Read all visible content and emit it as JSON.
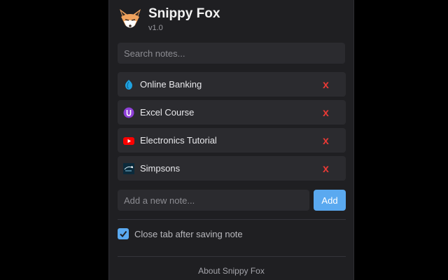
{
  "app": {
    "title": "Snippy Fox",
    "version": "v1.0"
  },
  "search": {
    "placeholder": "Search notes..."
  },
  "notes": [
    {
      "label": "Online Banking",
      "icon": "bank-icon",
      "delete_label": "x"
    },
    {
      "label": "Excel Course",
      "icon": "course-icon",
      "delete_label": "x"
    },
    {
      "label": "Electronics Tutorial",
      "icon": "youtube-icon",
      "delete_label": "x"
    },
    {
      "label": "Simpsons",
      "icon": "disney-plus-icon",
      "delete_label": "x"
    }
  ],
  "add_note": {
    "placeholder": "Add a new note...",
    "button_label": "Add"
  },
  "settings": {
    "close_tab_label": "Close tab after saving note",
    "close_tab_checked": true
  },
  "footer": {
    "about_label": "About Snippy Fox"
  },
  "colors": {
    "accent": "#5aa9f0",
    "delete": "#e53935",
    "background": "#1f1f22",
    "card": "#2b2b2f"
  }
}
